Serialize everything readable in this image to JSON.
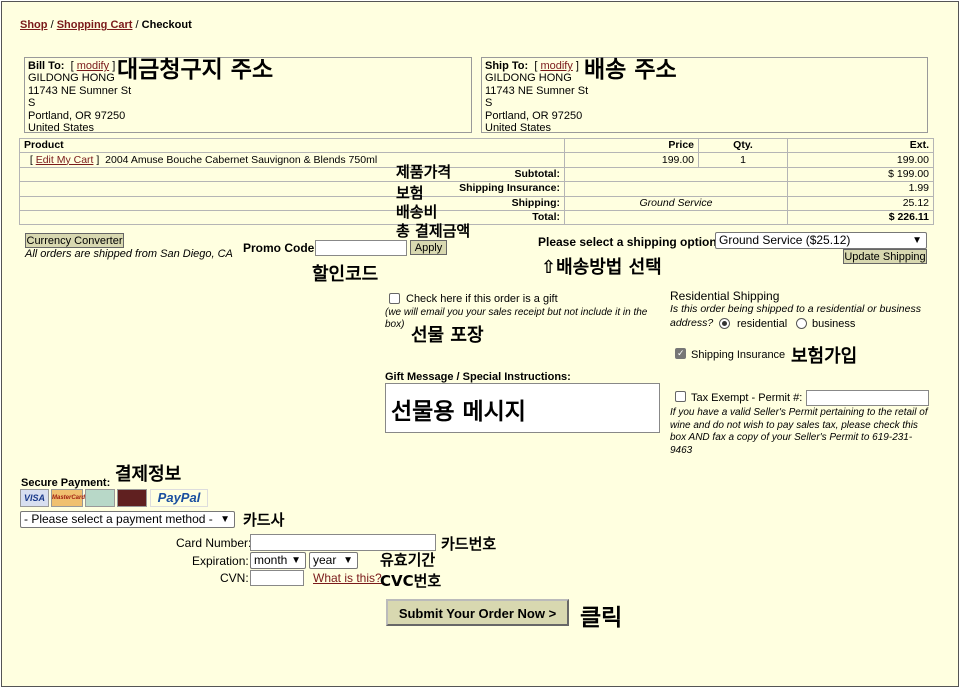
{
  "breadcrumb": {
    "shop": "Shop",
    "sep1": "/",
    "cart": "Shopping Cart",
    "sep2": "/",
    "current": "Checkout"
  },
  "bill": {
    "label": "Bill To:",
    "modify_open": "[",
    "modify": "modify",
    "modify_close": "]",
    "lines": [
      "GILDONG HONG",
      "11743 NE Sumner St",
      "S",
      "Portland, OR 97250",
      "United States"
    ]
  },
  "ship": {
    "label": "Ship To:",
    "modify_open": "[",
    "modify": "modify",
    "modify_close": "]",
    "lines": [
      "GILDONG HONG",
      "11743 NE Sumner St",
      "S",
      "Portland, OR 97250",
      "United States"
    ]
  },
  "cart": {
    "headers": {
      "product": "Product",
      "price": "Price",
      "qty": "Qty.",
      "ext": "Ext."
    },
    "edit_open": "[",
    "edit": "Edit My Cart",
    "edit_close": "]",
    "item": {
      "name": "2004 Amuse Bouche Cabernet Sauvignon & Blends 750ml",
      "price": "199.00",
      "qty": "1",
      "ext": "199.00"
    },
    "subtotal": {
      "label": "Subtotal:",
      "value": "$ 199.00"
    },
    "insurance": {
      "label": "Shipping Insurance:",
      "value": "1.99"
    },
    "shipping": {
      "label": "Shipping:",
      "method": "Ground Service",
      "value": "25.12"
    },
    "total": {
      "label": "Total:",
      "value": "$ 226.11"
    }
  },
  "currency_button": "Currency Converter",
  "ship_note": "All orders are shipped from San Diego, CA",
  "promo": {
    "label": "Promo Code:",
    "value": "",
    "apply": "Apply"
  },
  "shipping_option": {
    "label": "Please select a shipping option:",
    "selected": "Ground Service ($25.12)",
    "update": "Update Shipping"
  },
  "gift": {
    "check_label": "Check here if this order is a gift",
    "note": "(we will email you your sales receipt but not include it in the box)",
    "checked": false
  },
  "gift_message": {
    "label": "Gift Message / Special Instructions:"
  },
  "residential": {
    "title": "Residential Shipping",
    "question": "Is this order being shipped to a residential or business address?",
    "opt_residential": "residential",
    "opt_business": "business",
    "selected": "residential"
  },
  "insurance_opt": {
    "label": "Shipping Insurance",
    "checked": true
  },
  "tax": {
    "label": "Tax Exempt - Permit #:",
    "checked": false,
    "note": "If you have a valid Seller's Permit pertaining to the retail of wine and do not wish to pay sales tax, please check this box AND fax a copy of your Seller's Permit to 619-231-9463"
  },
  "payment": {
    "label": "Secure Payment:",
    "cards": [
      "VISA",
      "MasterCard",
      "",
      "",
      "PayPal"
    ],
    "select": "- Please select a payment method -",
    "card_number_label": "Card Number:",
    "expiration_label": "Expiration:",
    "month": "month",
    "year": "year",
    "cvn_label": "CVN:",
    "what": "What is this?",
    "submit": "Submit Your Order Now >"
  },
  "annotations": {
    "bill_addr": "대금청구지 주소",
    "ship_addr": "배송 주소",
    "product_price": "제품가격",
    "insurance": "보험",
    "shipping_fee": "배송비",
    "total": "총 결제금액",
    "promo": "할인코드",
    "ship_method": "⇧배송방법 선택",
    "gift_wrap": "선물 포장",
    "insurance_join": "보험가입",
    "gift_msg": "선물용 메시지",
    "payment_info": "결제정보",
    "card_company": "카드사",
    "card_number": "카드번호",
    "expiry": "유효기간",
    "cvc": "CVC번호",
    "click": "클릭"
  },
  "colors": {
    "background": "#ffffe0",
    "link": "#7a1a1a",
    "button": "#d8d8b0"
  }
}
